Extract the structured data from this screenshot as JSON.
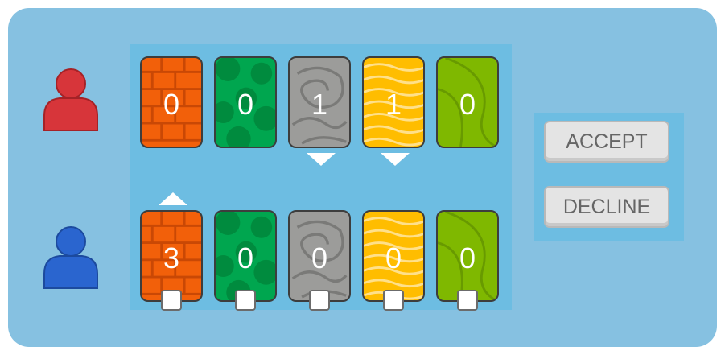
{
  "players": [
    {
      "name": "opponent",
      "color": "#d7353a"
    },
    {
      "name": "self",
      "color": "#2a65cf"
    }
  ],
  "resources": [
    {
      "type": "brick",
      "icon": "brick-card-icon",
      "color": "#f2600a"
    },
    {
      "type": "forest",
      "icon": "forest-card-icon",
      "color": "#00a64f"
    },
    {
      "type": "stone",
      "icon": "stone-card-icon",
      "color": "#9c9c9a"
    },
    {
      "type": "wheat",
      "icon": "wheat-card-icon",
      "color": "#ffbd00"
    },
    {
      "type": "pasture",
      "icon": "pasture-card-icon",
      "color": "#7fb800"
    }
  ],
  "trade": {
    "opponent_counts": [
      "0",
      "0",
      "1",
      "1",
      "0"
    ],
    "self_counts": [
      "3",
      "0",
      "0",
      "0",
      "0"
    ]
  },
  "actions": {
    "accept_label": "ACCEPT",
    "decline_label": "DECLINE"
  }
}
